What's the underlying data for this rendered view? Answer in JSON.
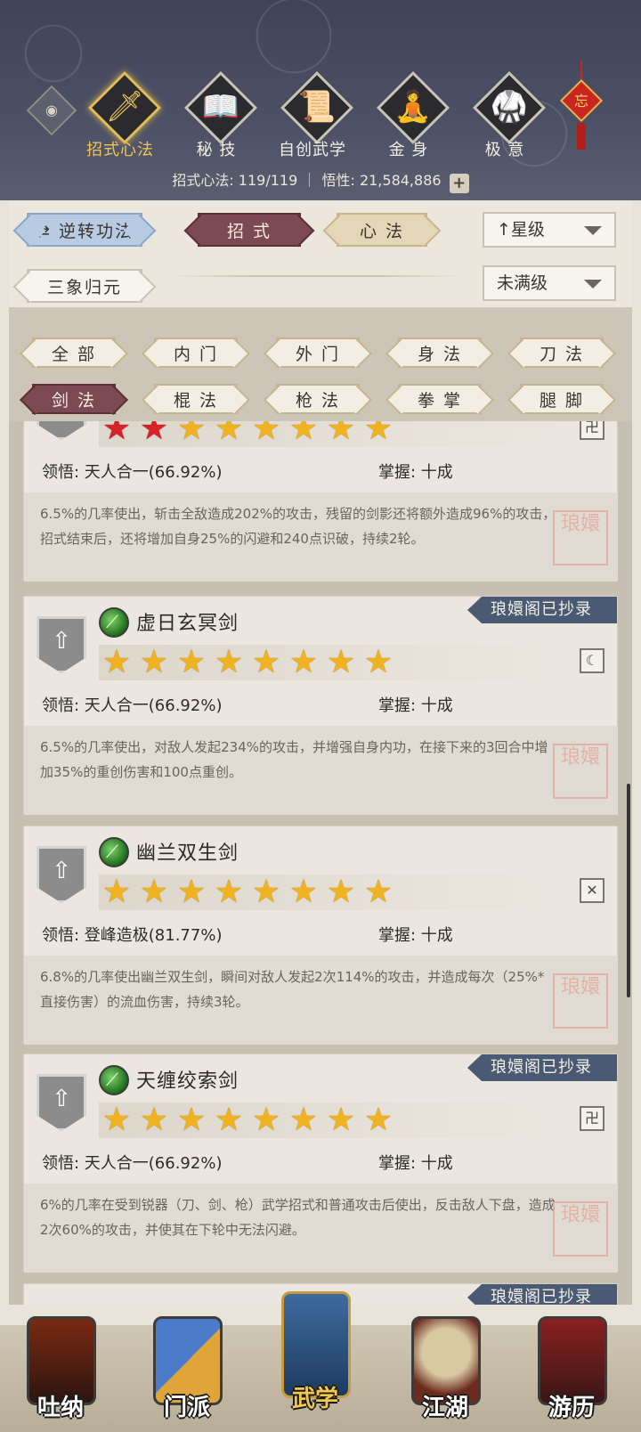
{
  "header": {
    "eye_icon": "eye-icon",
    "tabs": [
      {
        "label": "招式心法",
        "icon": "sword-icon",
        "active": true
      },
      {
        "label": "秘 技",
        "icon": "book-icon",
        "active": false
      },
      {
        "label": "自创武学",
        "icon": "scroll-icon",
        "active": false
      },
      {
        "label": "金 身",
        "icon": "meditation-icon",
        "active": false
      },
      {
        "label": "极 意",
        "icon": "martial-pose-icon",
        "active": false
      }
    ],
    "knot_char": "忘",
    "stats": {
      "moves_label": "招式心法: 119/119",
      "insight_label": "悟性: 21,584,886",
      "plus": "+"
    }
  },
  "filters": {
    "reverse_label": "逆转功法",
    "reverse_icon": "swap-arrows-icon",
    "tab_moves": "招 式",
    "tab_mind": "心 法",
    "sort_dropdown": "星级",
    "sort_prefix": "↑",
    "sanxiang_label": "三象归元",
    "level_dropdown": "未满级"
  },
  "types": [
    {
      "label": "全 部",
      "selected": false
    },
    {
      "label": "内 门",
      "selected": false
    },
    {
      "label": "外 门",
      "selected": false
    },
    {
      "label": "身 法",
      "selected": false
    },
    {
      "label": "刀 法",
      "selected": false
    },
    {
      "label": "剑 法",
      "selected": true
    },
    {
      "label": "棍 法",
      "selected": false
    },
    {
      "label": "枪 法",
      "selected": false
    },
    {
      "label": "拳 掌",
      "selected": false
    },
    {
      "label": "腿 脚",
      "selected": false
    }
  ],
  "skills": [
    {
      "name": "",
      "ribbon": "",
      "stars_total": 8,
      "red_stars": 2,
      "comprehension": "领悟:  天人合一(66.92%)",
      "mastery": "掌握:  十成",
      "desc": "6.5%的几率使出，斩击全敌造成202%的攻击，残留的剑影还将额外造成96%的攻击，招式结束后，还将增加自身25%的闪避和240点识破，持续2轮。",
      "seal": "卍"
    },
    {
      "name": "虚日玄冥剑",
      "ribbon": "琅嬛阁已抄录",
      "stars_total": 8,
      "red_stars": 0,
      "comprehension": "领悟:  天人合一(66.92%)",
      "mastery": "掌握:  十成",
      "desc": "6.5%的几率使出，对敌人发起234%的攻击，并增强自身内功，在接下来的3回合中增加35%的重创伤害和100点重创。",
      "seal": "☾"
    },
    {
      "name": "幽兰双生剑",
      "ribbon": "",
      "stars_total": 8,
      "red_stars": 0,
      "comprehension": "领悟:  登峰造极(81.77%)",
      "mastery": "掌握:  十成",
      "desc": "6.8%的几率使出幽兰双生剑，瞬间对敌人发起2次114%的攻击，并造成每次（25%*直接伤害）的流血伤害，持续3轮。",
      "seal": "✕"
    },
    {
      "name": "天缠绞索剑",
      "ribbon": "琅嬛阁已抄录",
      "stars_total": 8,
      "red_stars": 0,
      "comprehension": "领悟:  天人合一(66.92%)",
      "mastery": "掌握:  十成",
      "desc": "6%的几率在受到锐器（刀、剑、枪）武学招式和普通攻击后使出，反击敌人下盘，造成2次60%的攻击，并使其在下轮中无法闪避。",
      "seal": "卍"
    }
  ],
  "stamp_text": "琅嬛",
  "bottom_nav": [
    {
      "label": "吐纳",
      "icon": "monk-icon",
      "active": false
    },
    {
      "label": "门派",
      "icon": "sect-banner-icon",
      "active": false
    },
    {
      "label": "武学",
      "icon": "books-icon",
      "active": true
    },
    {
      "label": "江湖",
      "icon": "straw-hat-icon",
      "active": false
    },
    {
      "label": "游历",
      "icon": "horse-icon",
      "active": false
    }
  ],
  "colors": {
    "accent_gold": "#f2c453",
    "selected_red": "#7b4a52",
    "ribbon_blue": "#4b5a73",
    "star_gold": "#f0b31f",
    "star_red": "#d8222a"
  }
}
